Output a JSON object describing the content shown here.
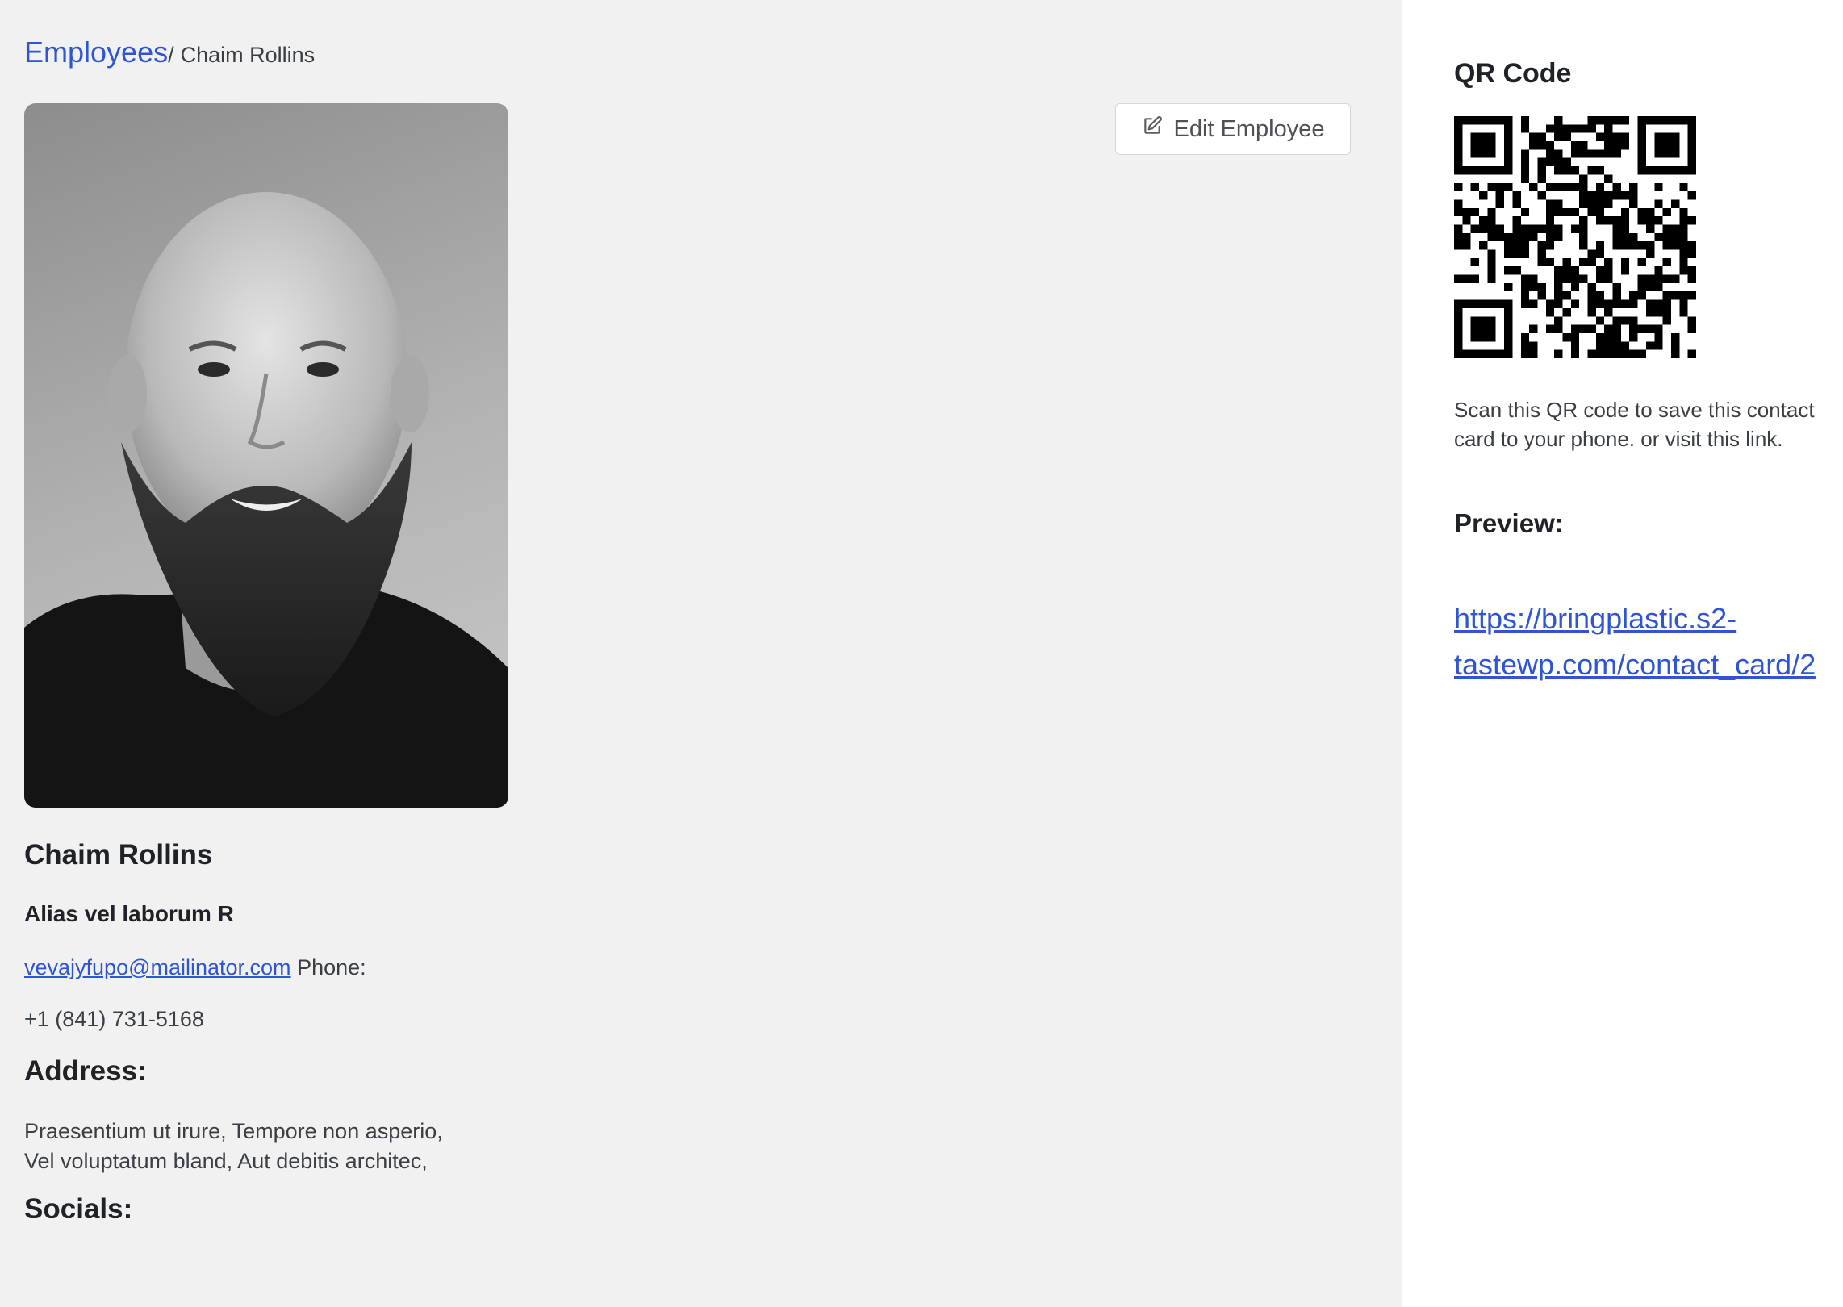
{
  "breadcrumb": {
    "parent": "Employees",
    "separator": "/",
    "current": "Chaim Rollins"
  },
  "actions": {
    "edit_label": "Edit Employee",
    "edit_icon": "edit-icon"
  },
  "employee": {
    "photo_alt": "Chaim Rollins",
    "name": "Chaim Rollins",
    "title": "Alias vel laborum R",
    "email": "vevajyfupo@mailinator.com",
    "phone_label": "Phone:",
    "phone": "+1 (841) 731-5168",
    "address_heading": "Address:",
    "address_line1": "Praesentium ut irure, Tempore non asperio,",
    "address_line2": "Vel voluptatum bland, Aut debitis architec,",
    "socials_heading": "Socials:"
  },
  "sidebar": {
    "qr_title": "QR Code",
    "qr_description": "Scan this QR code to save this contact card to your phone. or visit this link.",
    "preview_heading": "Preview:",
    "preview_link": "https://bringplastic.s2-tastewp.com/contact_card/2"
  },
  "colors": {
    "accent_link": "#2f55d4",
    "page_background": "#f1f1f1",
    "sidebar_background": "#ffffff"
  }
}
